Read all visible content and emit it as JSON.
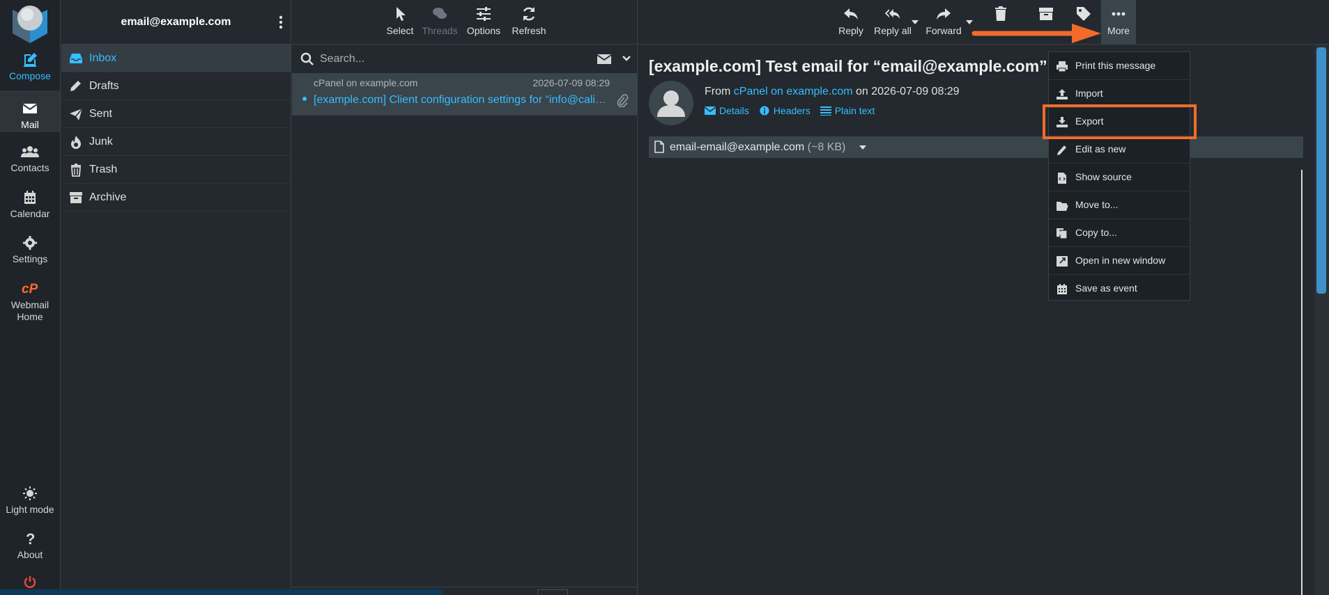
{
  "rail": {
    "items": [
      {
        "label": "Compose",
        "icon": "compose-icon"
      },
      {
        "label": "Mail",
        "icon": "mail-icon"
      },
      {
        "label": "Contacts",
        "icon": "contacts-icon"
      },
      {
        "label": "Calendar",
        "icon": "calendar-icon"
      },
      {
        "label": "Settings",
        "icon": "gear-icon"
      },
      {
        "label": "Webmail Home",
        "icon": "cpanel-icon"
      },
      {
        "label": "Light mode",
        "icon": "sun-icon"
      },
      {
        "label": "About",
        "icon": "question-icon"
      }
    ]
  },
  "folders": {
    "account": "email@example.com",
    "items": [
      {
        "label": "Inbox",
        "icon": "inbox-icon"
      },
      {
        "label": "Drafts",
        "icon": "pencil-icon"
      },
      {
        "label": "Sent",
        "icon": "paper-plane-icon"
      },
      {
        "label": "Junk",
        "icon": "fire-icon"
      },
      {
        "label": "Trash",
        "icon": "trash-icon"
      },
      {
        "label": "Archive",
        "icon": "archive-icon"
      }
    ]
  },
  "list_toolbar": {
    "select": "Select",
    "threads": "Threads",
    "options": "Options",
    "refresh": "Refresh"
  },
  "search": {
    "placeholder": "Search..."
  },
  "messages": [
    {
      "from": "cPanel on example.com",
      "date": "2026-07-09 08:29",
      "subject": "[example.com] Client configuration settings for “info@calis…",
      "has_attachment": true
    }
  ],
  "reader_toolbar": {
    "reply": "Reply",
    "reply_all": "Reply all",
    "forward": "Forward",
    "more": "More"
  },
  "message": {
    "subject": "[example.com] Test email for “email@example.com”.",
    "from_prefix": "From",
    "from_name": "cPanel on example.com",
    "on_word": "on",
    "date": "2026-07-09 08:29",
    "links": {
      "details": "Details",
      "headers": "Headers",
      "plain_text": "Plain text"
    },
    "attachment": {
      "name": "email-email@example.com",
      "size": "(~8 KB)"
    }
  },
  "more_menu": {
    "items": [
      {
        "label": "Print this message",
        "icon": "print-icon"
      },
      {
        "label": "Import",
        "icon": "upload-icon"
      },
      {
        "label": "Export",
        "icon": "download-icon"
      },
      {
        "label": "Edit as new",
        "icon": "pencil-icon"
      },
      {
        "label": "Show source",
        "icon": "source-icon"
      },
      {
        "label": "Move to...",
        "icon": "folder-open-icon",
        "submenu": true
      },
      {
        "label": "Copy to...",
        "icon": "copy-icon",
        "submenu": true
      },
      {
        "label": "Open in new window",
        "icon": "external-window-icon"
      },
      {
        "label": "Save as event",
        "icon": "calendar-icon"
      }
    ]
  },
  "colors": {
    "accent": "#37beff",
    "highlight": "#f26b2a",
    "background": "#23292e"
  }
}
